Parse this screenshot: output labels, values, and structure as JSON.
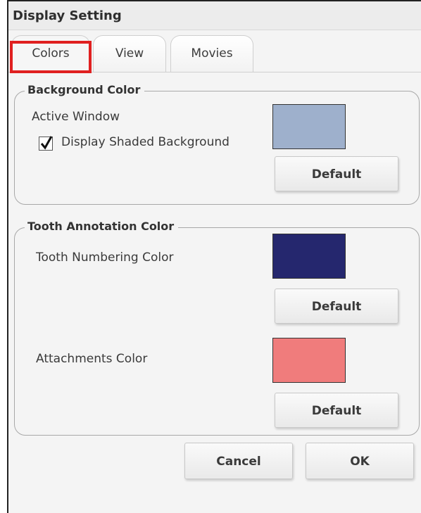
{
  "window": {
    "title": "Display Setting"
  },
  "tabs": [
    {
      "label": "Colors",
      "active": true
    },
    {
      "label": "View",
      "active": false
    },
    {
      "label": "Movies",
      "active": false
    }
  ],
  "background_group": {
    "legend": "Background Color",
    "active_window_label": "Active Window",
    "shaded_checkbox": {
      "label": "Display Shaded Background",
      "checked": true
    },
    "swatch_color": "#9eb0cc",
    "default_label": "Default"
  },
  "annotation_group": {
    "legend": "Tooth Annotation Color",
    "numbering_label": "Tooth Numbering Color",
    "numbering_color": "#25276e",
    "numbering_default_label": "Default",
    "attachments_label": "Attachments Color",
    "attachments_color": "#f07c7c",
    "attachments_default_label": "Default"
  },
  "footer": {
    "cancel_label": "Cancel",
    "ok_label": "OK"
  },
  "accent": {
    "highlight_color": "#e02020"
  }
}
